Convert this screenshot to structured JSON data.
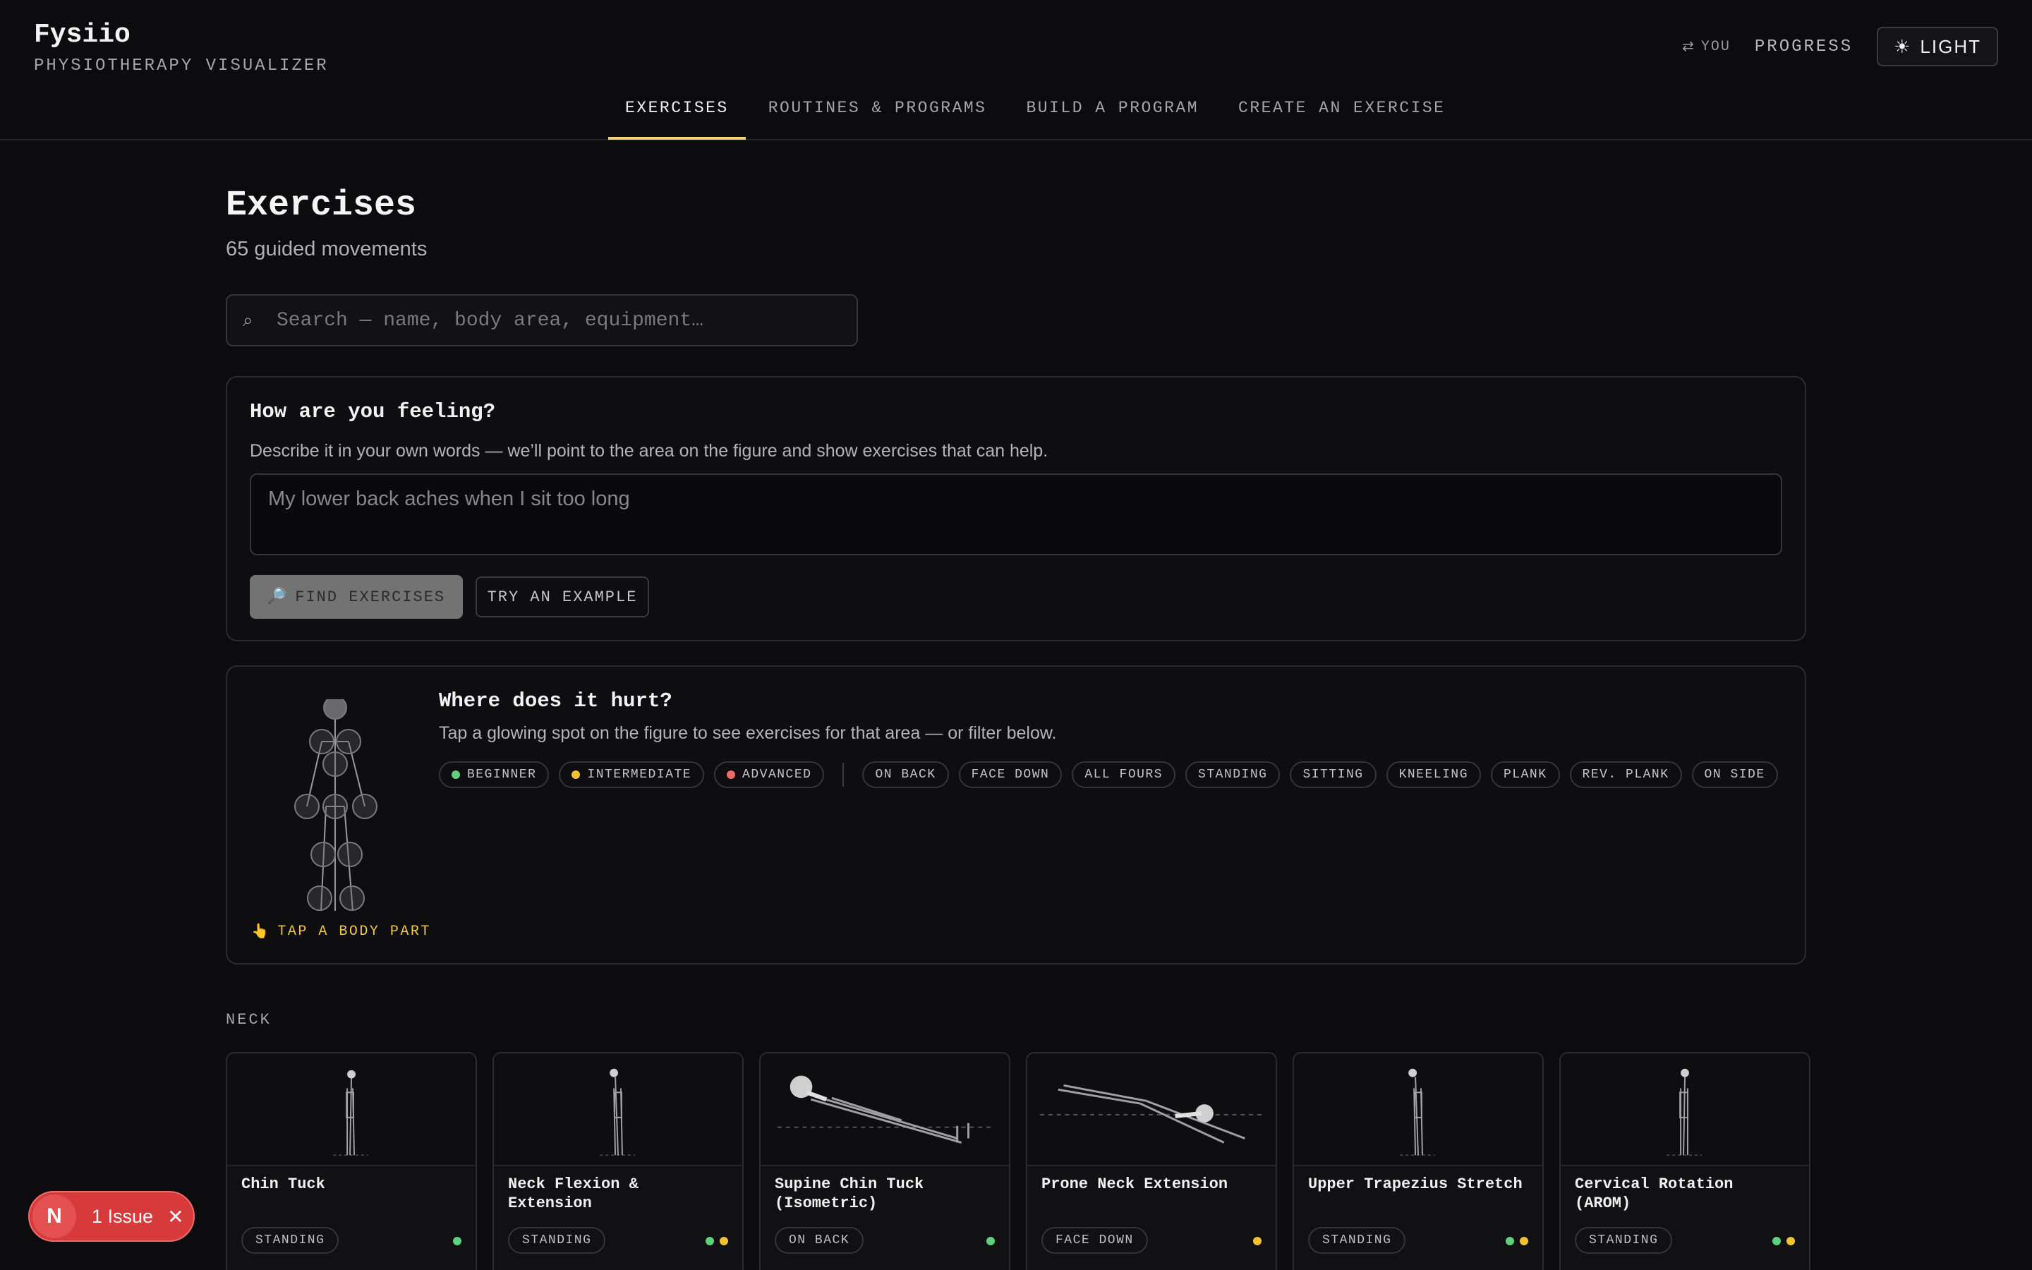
{
  "header": {
    "title": "Fysiio",
    "subtitle": "PHYSIOTHERAPY VISUALIZER",
    "you_label": "YOU",
    "progress_label": "PROGRESS",
    "theme_label": "LIGHT",
    "tabs": [
      {
        "label": "EXERCISES",
        "active": true
      },
      {
        "label": "ROUTINES & PROGRAMS",
        "active": false
      },
      {
        "label": "BUILD A PROGRAM",
        "active": false
      },
      {
        "label": "CREATE AN EXERCISE",
        "active": false
      }
    ]
  },
  "main": {
    "title": "Exercises",
    "subtitle": "65 guided movements",
    "search_placeholder": "Search — name, body area, equipment…"
  },
  "feeling": {
    "title": "How are you feeling?",
    "description": "Describe it in your own words — we’ll point to the area on the figure and show exercises that can help.",
    "input_placeholder": "My lower back aches when I sit too long",
    "find_label": "FIND EXERCISES",
    "example_label": "TRY AN EXAMPLE"
  },
  "hurt": {
    "title": "Where does it hurt?",
    "description": "Tap a glowing spot on the figure to see exercises for that area — or filter below.",
    "tap_label": "TAP A BODY PART",
    "levels": [
      {
        "label": "BEGINNER",
        "color": "#5fd07f"
      },
      {
        "label": "INTERMEDIATE",
        "color": "#f2c231"
      },
      {
        "label": "ADVANCED",
        "color": "#f06a6a"
      }
    ],
    "positions": [
      "ON BACK",
      "FACE DOWN",
      "ALL FOURS",
      "STANDING",
      "SITTING",
      "KNEELING",
      "PLANK",
      "REV. PLANK",
      "ON SIDE"
    ]
  },
  "section": {
    "label": "NECK",
    "exercises": [
      {
        "name": "Chin Tuck",
        "position": "STANDING",
        "levels": [
          "#5fd07f"
        ]
      },
      {
        "name": "Neck Flexion & Extension",
        "position": "STANDING",
        "levels": [
          "#5fd07f",
          "#f2c231"
        ]
      },
      {
        "name": "Supine Chin Tuck (Isometric)",
        "position": "ON BACK",
        "levels": [
          "#5fd07f"
        ]
      },
      {
        "name": "Prone Neck Extension",
        "position": "FACE DOWN",
        "levels": [
          "#f2c231"
        ]
      },
      {
        "name": "Upper Trapezius Stretch",
        "position": "STANDING",
        "levels": [
          "#5fd07f",
          "#f2c231"
        ]
      },
      {
        "name": "Cervical Rotation (AROM)",
        "position": "STANDING",
        "levels": [
          "#5fd07f",
          "#f2c231"
        ]
      }
    ]
  },
  "issue": {
    "label": "1 Issue"
  }
}
